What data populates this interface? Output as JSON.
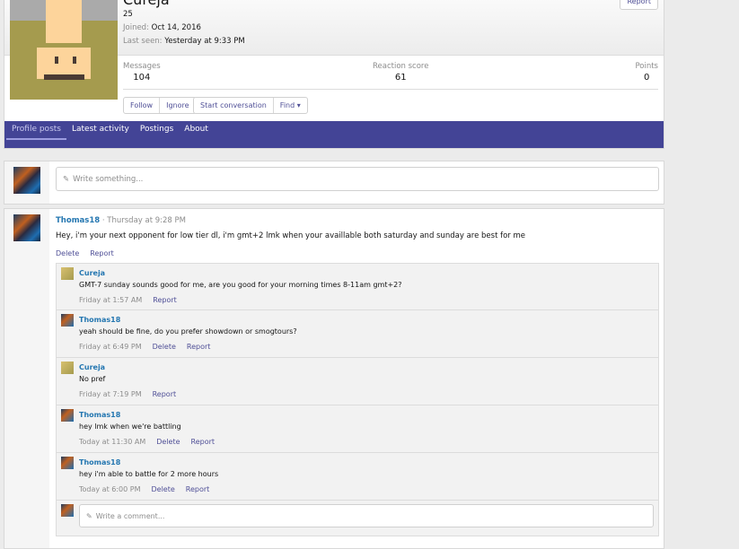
{
  "profile": {
    "username": "Cureja",
    "title": "25",
    "joined_label": "Joined:",
    "joined": "Oct 14, 2016",
    "last_seen_label": "Last seen:",
    "last_seen": "Yesterday at 9:33 PM",
    "report": "Report",
    "stats": [
      {
        "label": "Messages",
        "value": "104"
      },
      {
        "label": "Reaction score",
        "value": "61"
      },
      {
        "label": "Points",
        "value": "0"
      }
    ],
    "buttons": {
      "follow": "Follow",
      "ignore": "Ignore",
      "start": "Start conversation",
      "find": "Find ▾"
    }
  },
  "tabs": [
    "Profile posts",
    "Latest activity",
    "Postings",
    "About"
  ],
  "composer": {
    "placeholder": "Write something..."
  },
  "post": {
    "author": "Thomas18",
    "time": "· Thursday at 9:28 PM",
    "text": "Hey, i'm your next opponent for low tier dl, i'm gmt+2 lmk when your availlable both saturday and sunday are best for me",
    "delete": "Delete",
    "report": "Report",
    "comments": [
      {
        "author": "Cureja",
        "text": "GMT-7 sunday sounds good for me, are you good for your morning times 8-11am gmt+2?",
        "time": "Friday at 1:57 AM",
        "actions": [
          "Report"
        ]
      },
      {
        "author": "Thomas18",
        "text": "yeah should be fine, do you prefer showdown or smogtours?",
        "time": "Friday at 6:49 PM",
        "actions": [
          "Delete",
          "Report"
        ]
      },
      {
        "author": "Cureja",
        "text": "No pref",
        "time": "Friday at 7:19 PM",
        "actions": [
          "Report"
        ]
      },
      {
        "author": "Thomas18",
        "text": "hey lmk when we're battling",
        "time": "Today at 11:30 AM",
        "actions": [
          "Delete",
          "Report"
        ]
      },
      {
        "author": "Thomas18",
        "text": "hey i'm able to battle for 2 more hours",
        "time": "Today at 6:00 PM",
        "actions": [
          "Delete",
          "Report"
        ]
      }
    ],
    "comment_placeholder": "Write a comment..."
  }
}
